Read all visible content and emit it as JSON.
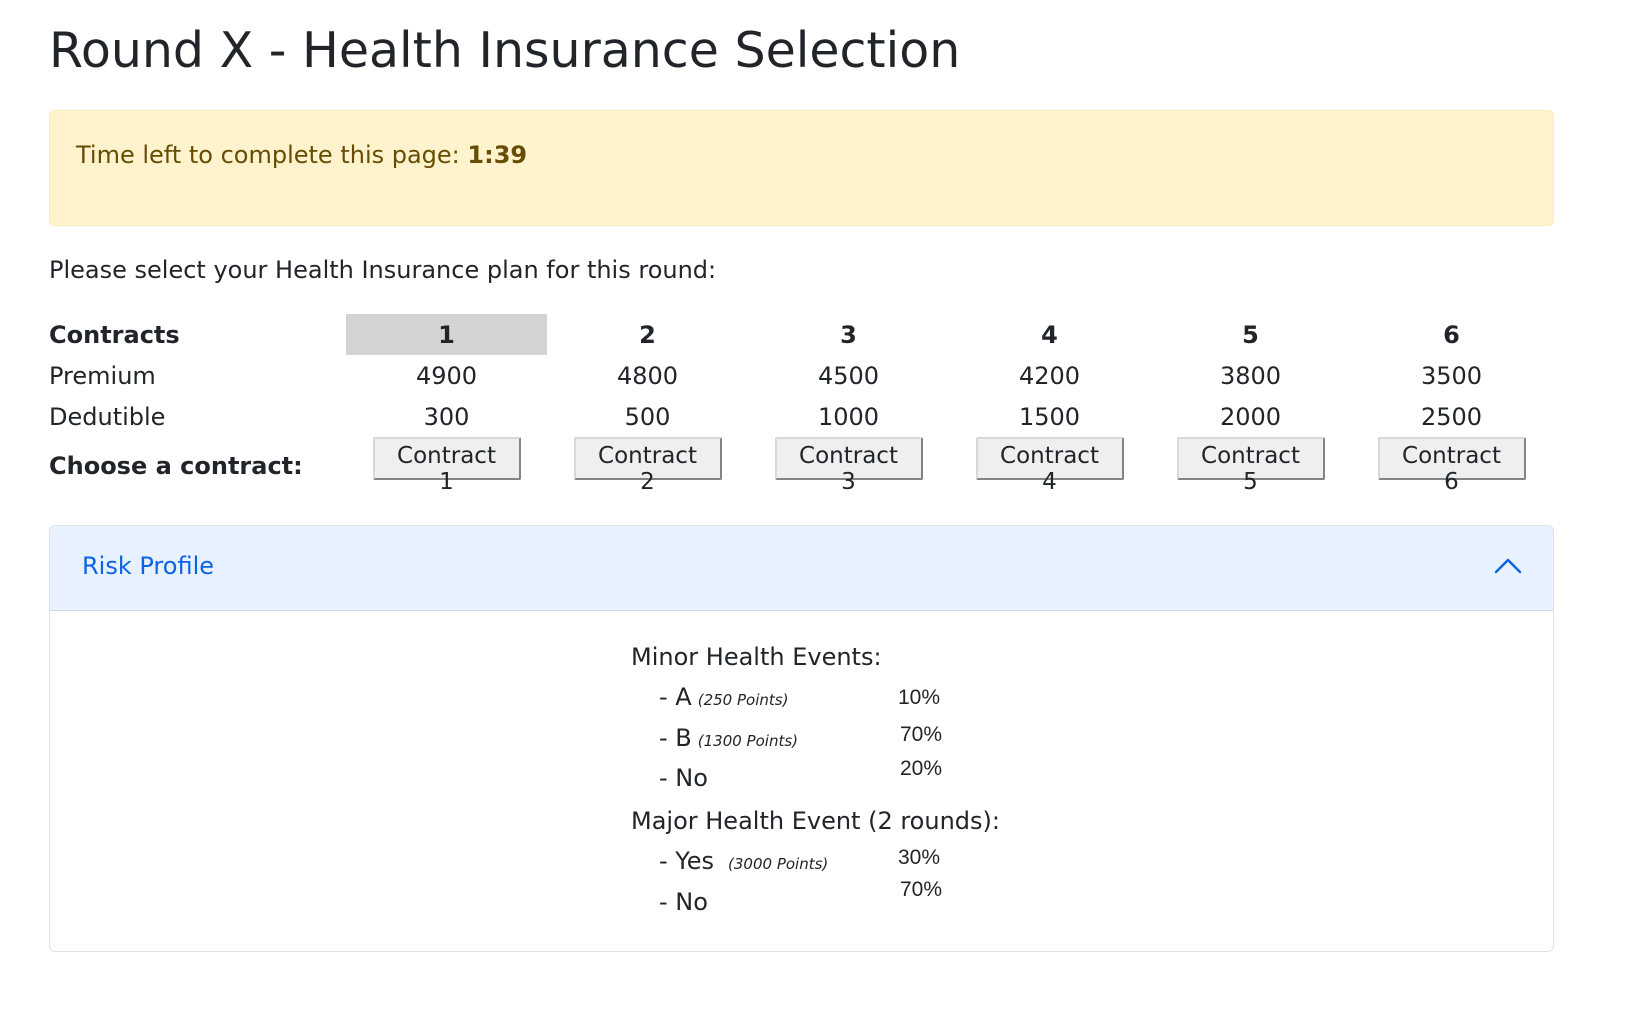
{
  "page_title": "Round X - Health Insurance Selection",
  "timer": {
    "label": "Time left to complete this page:",
    "value": "1:39"
  },
  "instruction": "Please select your Health Insurance plan for this round:",
  "table": {
    "row_labels": {
      "contracts": "Contracts",
      "premium": "Premium",
      "deductible": "Dedutible",
      "choose": "Choose a contract:"
    },
    "selected_contract": "1",
    "contracts": [
      {
        "id": "1",
        "premium": "4900",
        "deductible": "300",
        "button": "Contract 1"
      },
      {
        "id": "2",
        "premium": "4800",
        "deductible": "500",
        "button": "Contract 2"
      },
      {
        "id": "3",
        "premium": "4500",
        "deductible": "1000",
        "button": "Contract 3"
      },
      {
        "id": "4",
        "premium": "4200",
        "deductible": "1500",
        "button": "Contract 4"
      },
      {
        "id": "5",
        "premium": "3800",
        "deductible": "2000",
        "button": "Contract 5"
      },
      {
        "id": "6",
        "premium": "3500",
        "deductible": "2500",
        "button": "Contract 6"
      }
    ]
  },
  "risk_profile": {
    "title": "Risk Profile",
    "icon": "chevron-up-icon",
    "minor": {
      "heading": "Minor Health Events:",
      "items": [
        {
          "label": "- A",
          "points": "(250 Points)",
          "pct": "10%"
        },
        {
          "label": "- B",
          "points": "(1300 Points)",
          "pct": "70%"
        },
        {
          "label": "- No",
          "pct": "20%"
        }
      ]
    },
    "major": {
      "heading": "Major Health Event (2 rounds):",
      "items": [
        {
          "label": "- Yes",
          "points": "(3000 Points)",
          "pct": "30%"
        },
        {
          "label": "- No",
          "pct": "70%"
        }
      ]
    }
  },
  "colors": {
    "warning_bg": "#fff3cd",
    "warning_text": "#664d03",
    "accordion_bg": "#e7f1ff",
    "accent": "#0c63e4",
    "selected_col": "#d3d3d3"
  }
}
